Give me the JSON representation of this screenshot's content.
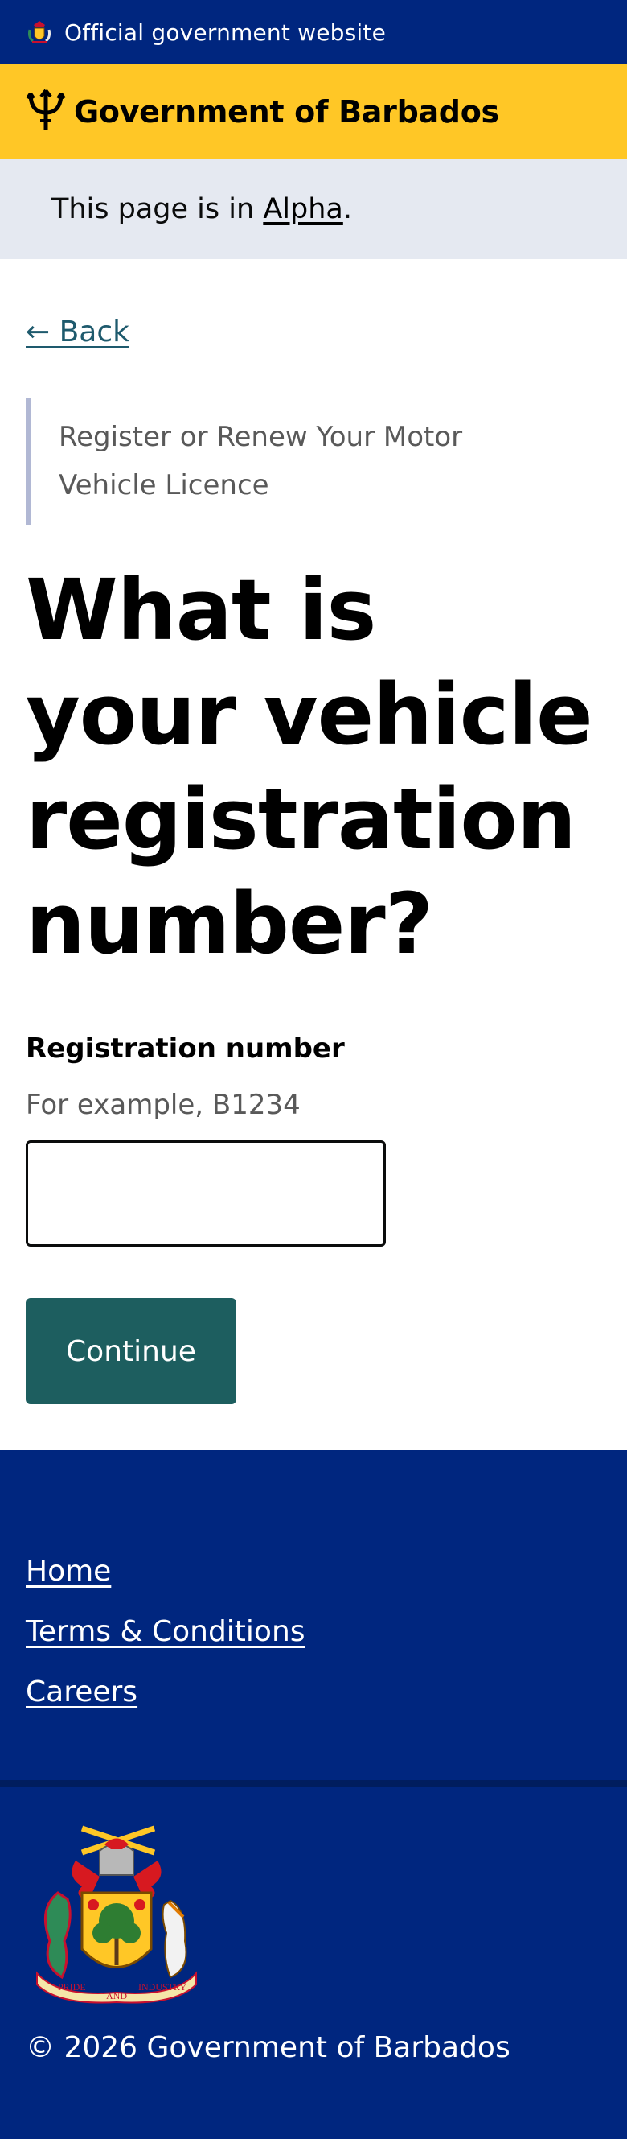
{
  "official_bar": {
    "text": "Official government website",
    "icon": "coat-of-arms-icon"
  },
  "header": {
    "title": "Government of Barbados",
    "icon": "trident-icon",
    "color": "#ffc726"
  },
  "phase_banner": {
    "prefix": "This page is in ",
    "phase": "Alpha",
    "suffix": "."
  },
  "back_link": "← Back",
  "caption": "Register or Renew Your Motor Vehicle Licence",
  "question": "What is your vehicle registration number?",
  "field": {
    "label": "Registration number",
    "hint": "For example, B1234",
    "value": ""
  },
  "continue_label": "Continue",
  "footer": {
    "links": [
      "Home",
      "Terms & Conditions",
      "Careers"
    ],
    "copyright": "© 2026 Government of Barbados",
    "emblem_motto": [
      "PRIDE",
      "AND",
      "INDUSTRY"
    ]
  },
  "colors": {
    "navy": "#00267f",
    "yellow": "#ffc726",
    "button": "#1d5e5f",
    "link": "#1e5a6d"
  }
}
